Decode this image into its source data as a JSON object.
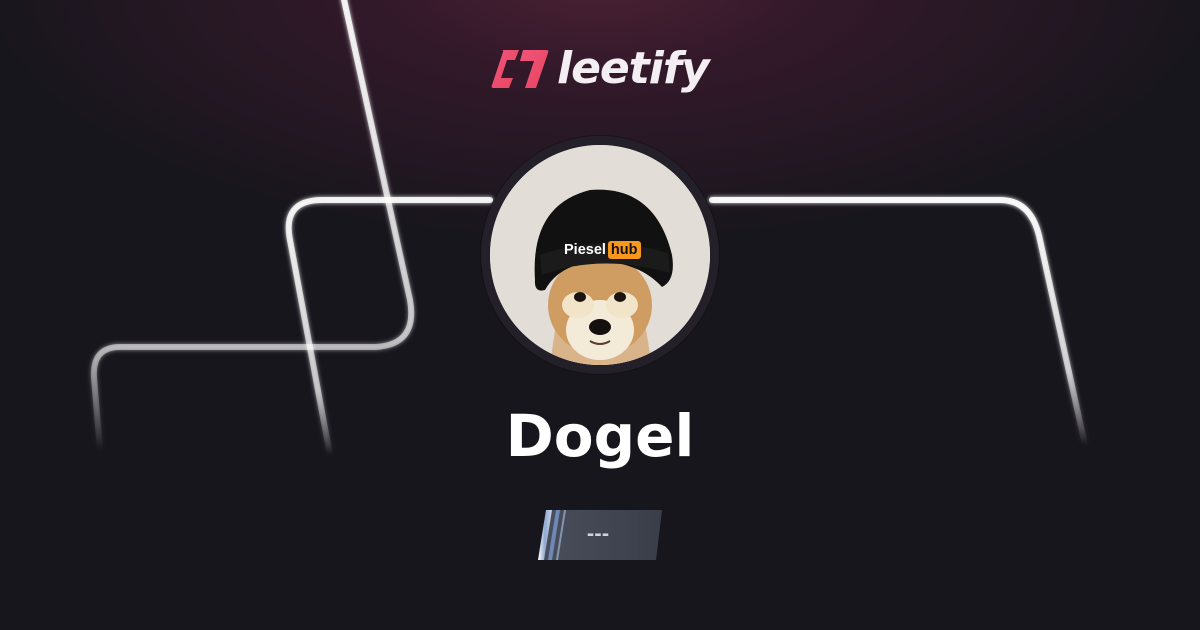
{
  "brand": {
    "name": "leetify",
    "logo_icon": "leetify-logo-icon",
    "accent_color": "#ea4d6f"
  },
  "profile": {
    "avatar_icon": "doge-avatar",
    "avatar_hat_text_left": "Piesel",
    "avatar_hat_text_right": "hub",
    "username": "Dogel"
  },
  "rank": {
    "icon": "rank-badge-icon",
    "value": "---"
  },
  "colors": {
    "background": "#18161d",
    "glow": "#4a2134",
    "line": "#ffffff",
    "text": "#ffffff"
  }
}
